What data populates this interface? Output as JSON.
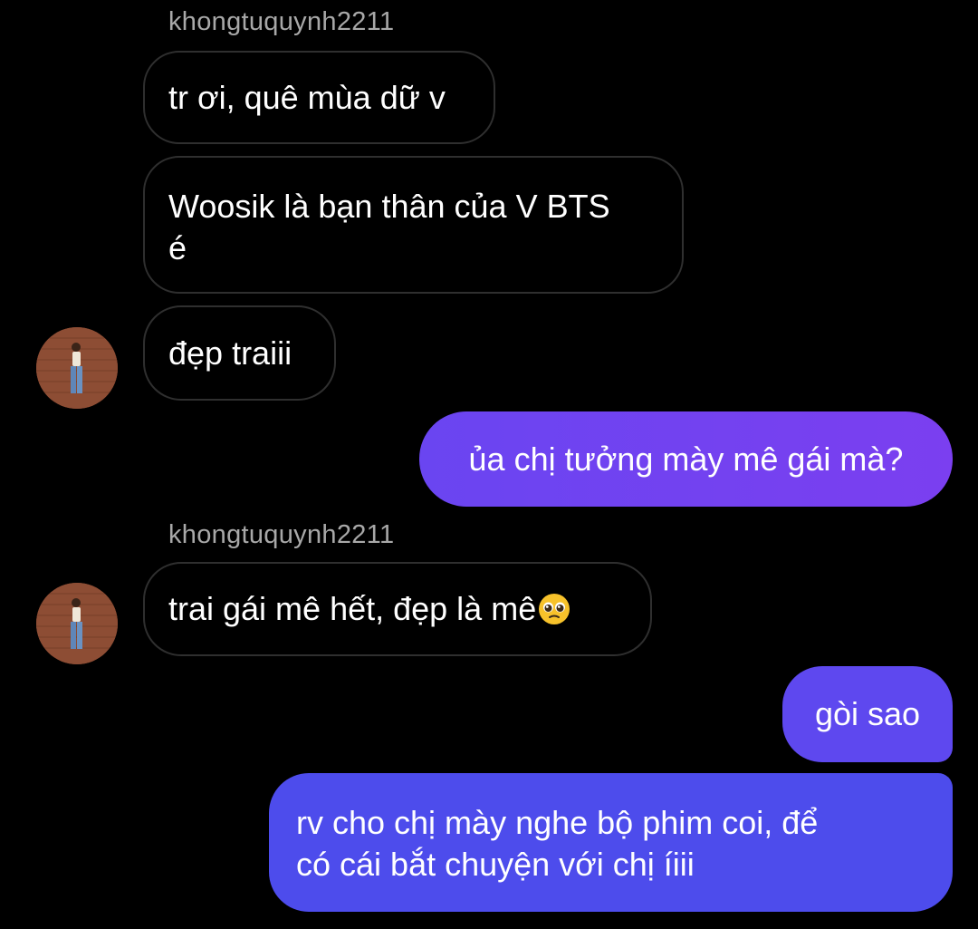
{
  "conversation": {
    "sender_username": "khongtuquynh2211",
    "messages": [
      {
        "direction": "incoming",
        "text": "tr ơi, quê mùa dữ v"
      },
      {
        "direction": "incoming",
        "text_line1": "Woosik là bạn thân của V BTS",
        "text_line2": "é"
      },
      {
        "direction": "incoming",
        "text": "đẹp traiii"
      },
      {
        "direction": "outgoing",
        "text": "ủa chị tưởng mày mê gái mà?"
      },
      {
        "direction": "incoming",
        "text": "trai gái mê hết, đẹp là mê",
        "emoji": "pleading-face-emoji"
      },
      {
        "direction": "outgoing",
        "text": "gòi sao"
      },
      {
        "direction": "outgoing",
        "text_line1": "rv cho chị mày nghe bộ phim coi, để",
        "text_line2": "có cái bắt chuyện với chị íiii"
      }
    ]
  },
  "colors": {
    "background": "#000000",
    "incoming_border": "#2f2f2f",
    "outgoing_gradient_top": "#7b3ff0",
    "outgoing_gradient_bottom": "#3d4ee8",
    "username_text": "#a8a8a8"
  },
  "icons": {
    "avatar": "profile-photo-avatar"
  }
}
